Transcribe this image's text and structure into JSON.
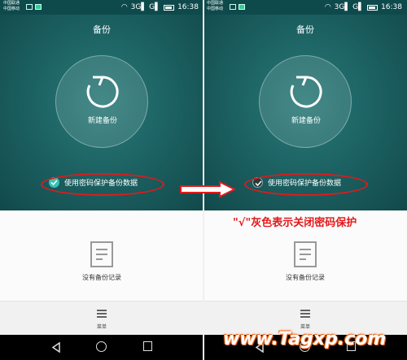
{
  "screens": [
    {
      "status": {
        "carrier_1": "中国联通",
        "carrier_2": "中国移动",
        "signal": "3G▌ G▌",
        "time": "16:38"
      },
      "title": "备份",
      "new_backup_label": "新建备份",
      "password_option": {
        "label": "使用密码保护备份数据",
        "checked_color": "#38c2b5",
        "state": "enabled"
      },
      "empty_state": "没有备份记录",
      "menu_label": "菜单"
    },
    {
      "status": {
        "carrier_1": "中国联通",
        "carrier_2": "中国移动",
        "signal": "3G▌ G▌",
        "time": "16:38"
      },
      "title": "备份",
      "new_backup_label": "新建备份",
      "password_option": {
        "label": "使用密码保护备份数据",
        "checked_color": "#2b3b3b",
        "state": "gray"
      },
      "empty_state": "没有备份记录",
      "menu_label": "菜单"
    }
  ],
  "annotation": {
    "text": "\"√\"灰色表示关闭密码保护",
    "color": "#e3191b"
  },
  "watermark": {
    "text": "www.Tagxp.com"
  },
  "colors": {
    "accent_teal": "#1d6364",
    "annotation_red": "#e3191b",
    "watermark_orange": "#f26b22"
  }
}
